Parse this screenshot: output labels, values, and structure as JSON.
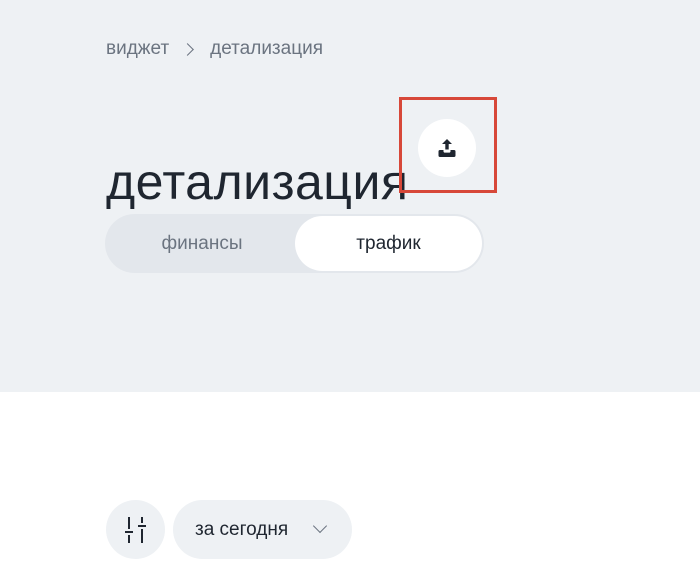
{
  "breadcrumb": {
    "items": [
      "виджет",
      "детализация"
    ]
  },
  "page": {
    "title": "детализация"
  },
  "export_button": {
    "icon": "upload-icon",
    "highlight_color": "#d74839"
  },
  "tabs": {
    "items": [
      {
        "label": "финансы",
        "active": false
      },
      {
        "label": "трафик",
        "active": true
      }
    ]
  },
  "filters": {
    "filter_icon": "sliders-icon",
    "period_value": "за сегодня",
    "period_icon": "chevron-down-icon"
  },
  "colors": {
    "top_background": "#eef1f4",
    "text_primary": "#1f2630",
    "text_secondary": "#6b7480",
    "highlight": "#d74839"
  }
}
